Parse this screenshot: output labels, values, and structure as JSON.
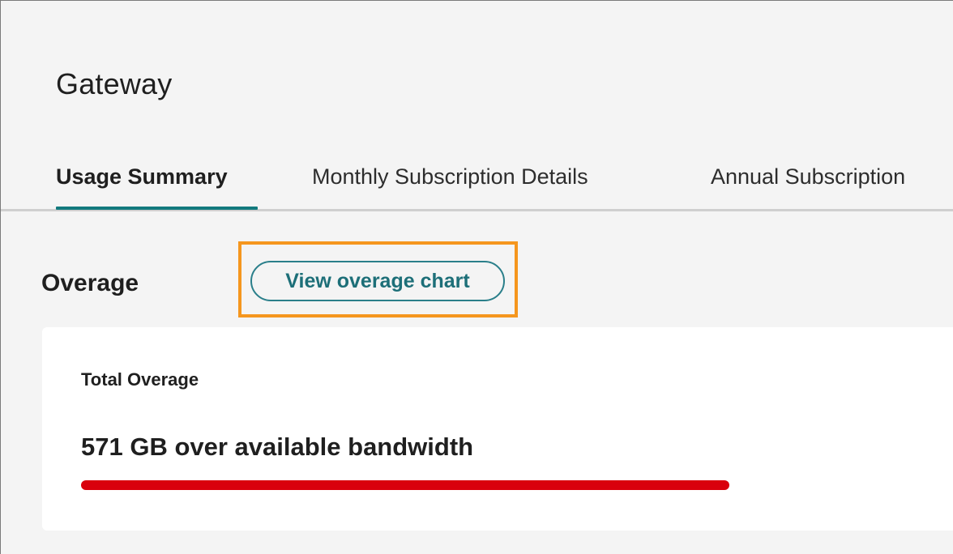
{
  "header": {
    "title": "Gateway"
  },
  "tabs": [
    {
      "label": "Usage Summary",
      "active": true
    },
    {
      "label": "Monthly Subscription Details",
      "active": false
    },
    {
      "label": "Annual Subscription",
      "active": false
    }
  ],
  "overage": {
    "section_title": "Overage",
    "chart_button_label": "View overage chart",
    "card_label": "Total Overage",
    "summary": "571 GB over available bandwidth",
    "bar_fraction": 1.0,
    "bar_color": "#d9000d"
  },
  "colors": {
    "accent": "#12797d",
    "highlight": "#f5961e",
    "danger": "#d9000d"
  }
}
